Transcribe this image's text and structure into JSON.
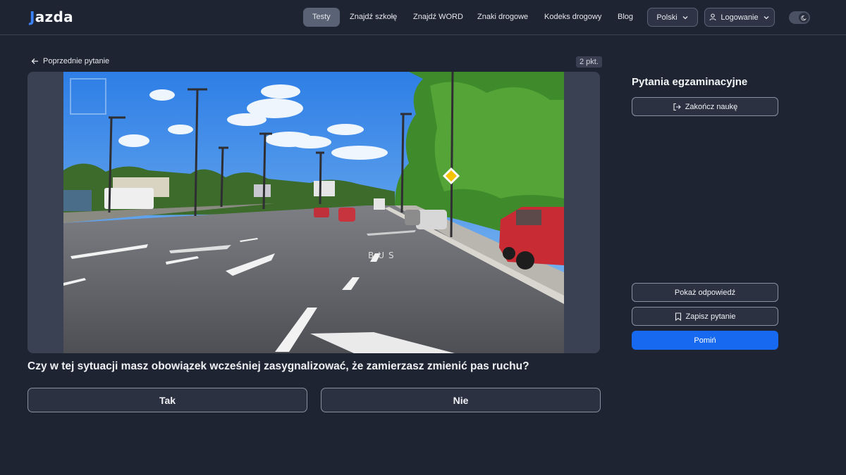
{
  "brand": {
    "logo_mark": "J",
    "logo_rest": "azda"
  },
  "nav": {
    "items": [
      {
        "label": "Testy",
        "active": true
      },
      {
        "label": "Znajdź szkołę"
      },
      {
        "label": "Znajdź WORD"
      },
      {
        "label": "Znaki drogowe"
      },
      {
        "label": "Kodeks drogowy"
      },
      {
        "label": "Blog"
      }
    ],
    "language": "Polski",
    "login": "Logowanie",
    "theme_toggle_icon": "moon-icon"
  },
  "question": {
    "back_label": "Poprzednie pytanie",
    "points": "2 pkt.",
    "text": "Czy w tej sytuacji masz obowiązek wcześniej zasygnalizować, że zamierzasz zmienić pas ruchu?",
    "answers": [
      "Tak",
      "Nie"
    ],
    "road_marking_text": "BUS"
  },
  "sidebar": {
    "title": "Pytania egzaminacyjne",
    "end_button": "Zakończ naukę",
    "show_answer": "Pokaż odpowiedź",
    "save_question": "Zapisz pytanie",
    "skip": "Pomiń"
  },
  "colors": {
    "background": "#1f2433",
    "accent": "#1769f0",
    "card": "#3a4152"
  }
}
